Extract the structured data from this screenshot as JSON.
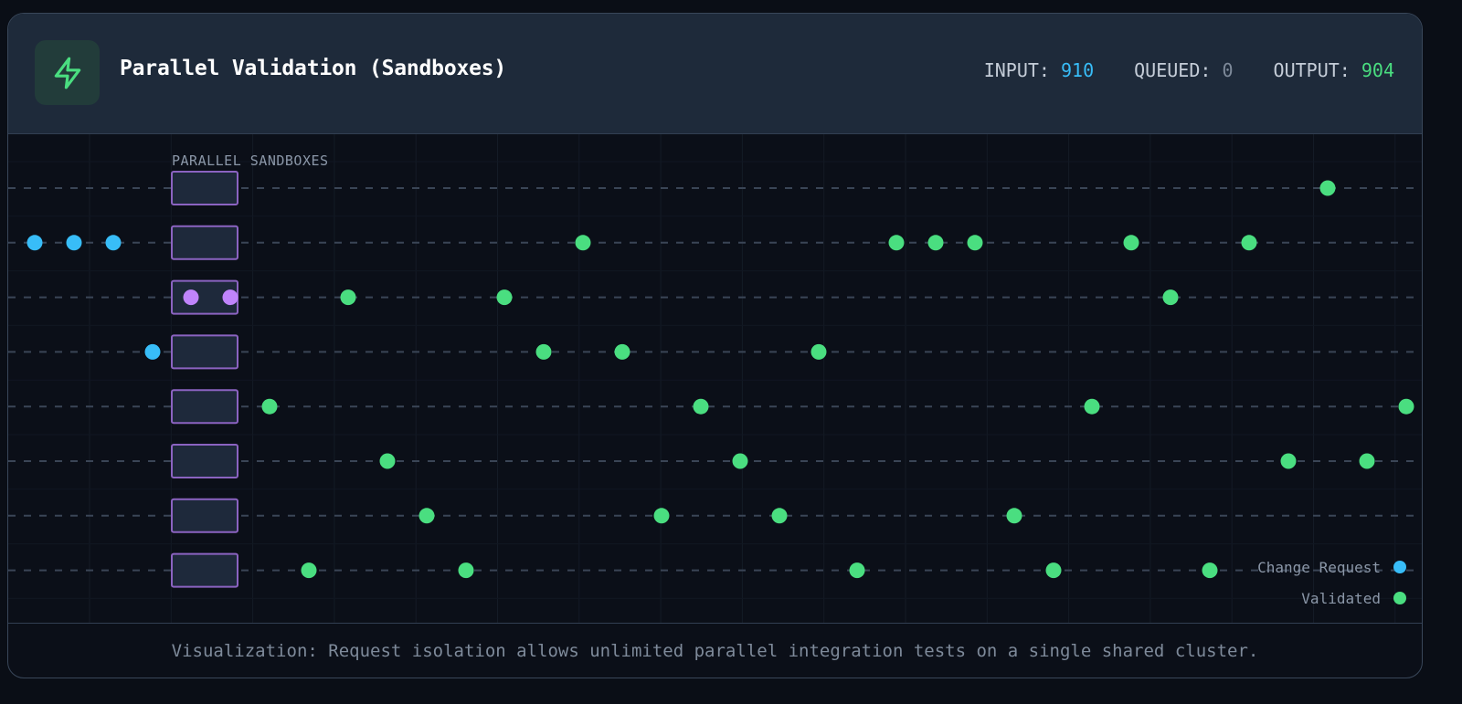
{
  "header": {
    "title": "Parallel Validation (Sandboxes)",
    "icon": "lightning-bolt-icon",
    "stats": {
      "input_label": "INPUT:",
      "input_value": "910",
      "queued_label": "QUEUED:",
      "queued_value": "0",
      "output_label": "OUTPUT:",
      "output_value": "904"
    }
  },
  "viz": {
    "section_label": "PARALLEL SANDBOXES",
    "lanes": 8,
    "sandboxes": [
      {
        "lane": 1,
        "processing": 0
      },
      {
        "lane": 2,
        "processing": 0
      },
      {
        "lane": 3,
        "processing": 2
      },
      {
        "lane": 4,
        "processing": 0
      },
      {
        "lane": 5,
        "processing": 0
      },
      {
        "lane": 6,
        "processing": 0
      },
      {
        "lane": 7,
        "processing": 0
      },
      {
        "lane": 8,
        "processing": 0
      }
    ],
    "legend": [
      {
        "label": "Change Request",
        "color": "#38bdf8"
      },
      {
        "label": "Validated",
        "color": "#4ade80"
      }
    ],
    "colors": {
      "request": "#38bdf8",
      "validated": "#4ade80",
      "processing": "#c084fc",
      "sandbox_border": "#8b63c1",
      "sandbox_fill": "#1e293b"
    }
  },
  "footer": {
    "caption": "Visualization: Request isolation allows unlimited parallel integration tests on a single shared cluster."
  }
}
